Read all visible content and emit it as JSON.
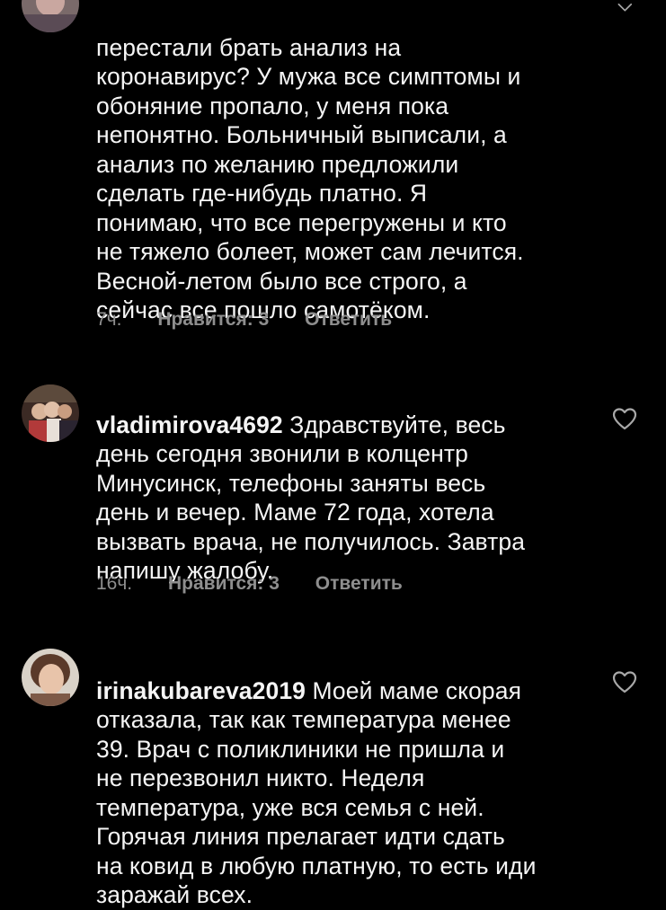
{
  "colors": {
    "background": "#000000",
    "text": "#f5f5f5",
    "secondary": "#8e8e8e"
  },
  "comments": [
    {
      "username": "",
      "text": "перестали брать анализ на\nкоронавирус? У мужа все симптомы и\nобоняние пропало, у меня пока\nнепонятно. Больничный выписали, а\nанализ по желанию предложили\nсделать где-нибудь платно. Я\nпонимаю, что все перегружены и кто\nне тяжело болеет, может сам лечится.\nВесной-летом было все строго, а\nсейчас  все пошло самотёком.",
      "time": "7ч.",
      "likes": "Нравится: 3",
      "reply": "Ответить",
      "icon": "chevron-down-icon"
    },
    {
      "username": "vladimirova4692",
      "text": " Здравствуйте,  весь\nдень сегодня звонили в колцентр\nМинусинск,  телефоны заняты весь\nдень и вечер. Маме 72 года, хотела\nвызвать врача, не получилось.  Завтра\nнапишу жалобу.",
      "time": "16ч.",
      "likes": "Нравится: 3",
      "reply": "Ответить",
      "icon": "heart-icon"
    },
    {
      "username": "irinakubareva2019",
      "text": " Моей маме скорая\nотказала, так как температура менее\n39. Врач с поликлиники не пришла и\nне перезвонил никто. Неделя\nтемпература, уже вся семья с ней.\nГорячая линия прелагает идти сдать\nна ковид в любую платную, то есть иди\nзаражай всех.",
      "icon": "heart-icon"
    }
  ]
}
